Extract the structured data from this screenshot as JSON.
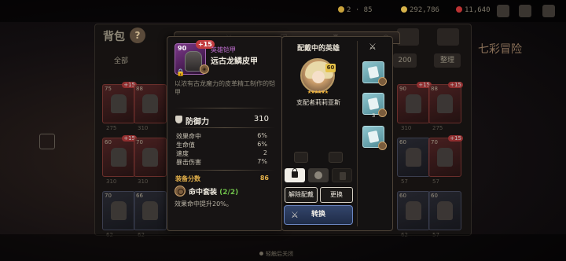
{
  "background": {
    "bag_title": "背包",
    "filter_all": "全部",
    "chip_count": "200",
    "chip_sort": "整理",
    "help": "?",
    "right_side_text": "七彩冒险"
  },
  "item": {
    "level": "90",
    "enhance": "+15",
    "type": "英雄铠甲",
    "name": "远古龙鳞皮甲",
    "description": "以浓有古龙魔力的皮革精工制作的铠甲",
    "main_stat": {
      "name": "防御力",
      "value": "310"
    },
    "sub_stats": [
      {
        "name": "效果命中",
        "value": "6%"
      },
      {
        "name": "生命值",
        "value": "6%"
      },
      {
        "name": "速度",
        "value": "2"
      },
      {
        "name": "暴击伤害",
        "value": "7%"
      }
    ],
    "score_label": "装备分数",
    "score": "86",
    "set_name": "命中套装",
    "set_count": "(2/2)",
    "set_effect": "效果命中提升20%。"
  },
  "hero_panel": {
    "title": "配戴中的英雄",
    "hero_level": "60",
    "hero_name": "支配者莉莉亚斯",
    "unequip_label": "解除配戴",
    "change_label": "更换",
    "swap_label": "转换",
    "mini_count": "3"
  },
  "footer": {
    "hint": "轻触后关闭"
  }
}
